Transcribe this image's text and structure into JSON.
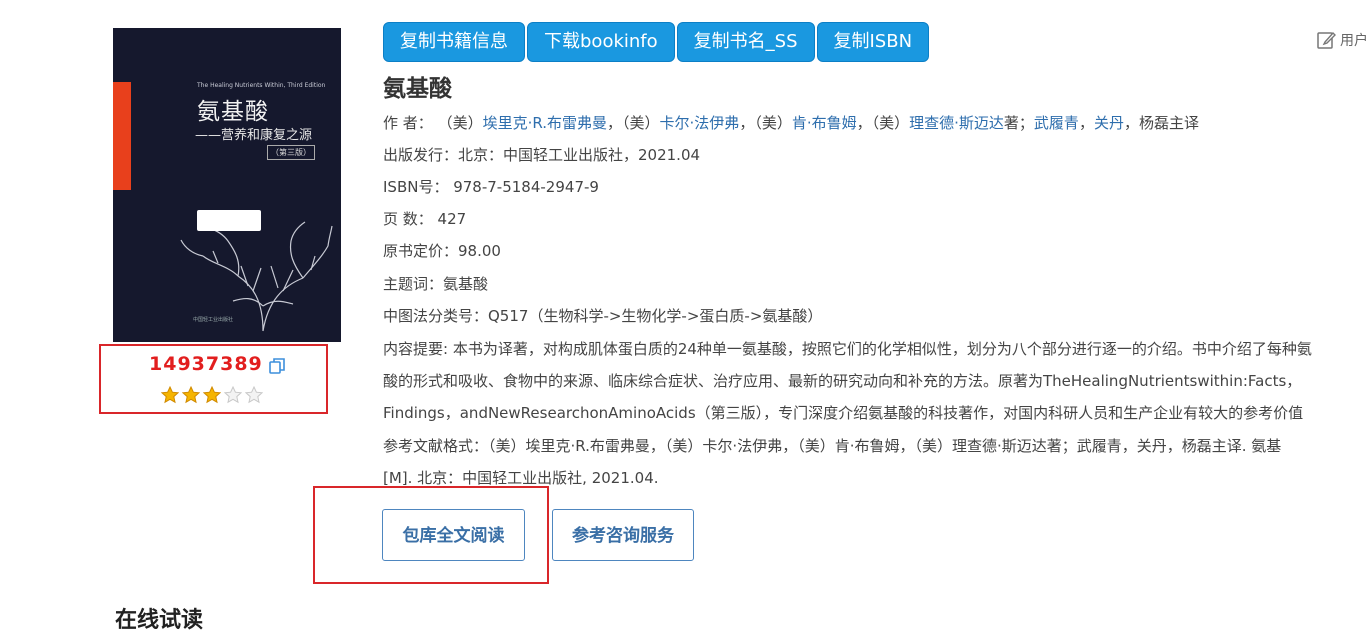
{
  "cover": {
    "english_title": "The Healing Nutrients Within, Third Edition",
    "chinese_title": "氨基酸",
    "chinese_subtitle": "——营养和康复之源",
    "edition": "（第三版）",
    "publisher_line": "中国轻工业出版社"
  },
  "book_id": {
    "number": "14937389",
    "rating": {
      "value": 3,
      "max": 5
    }
  },
  "toolbar": {
    "buttons": [
      "复制书籍信息",
      "下载bookinfo",
      "复制书名_SS",
      "复制ISBN"
    ],
    "user_label": "用户"
  },
  "book": {
    "title": "氨基酸",
    "authors": {
      "label": "作 者：",
      "prefix1": "（美）",
      "name1": "埃里克·R.布雷弗曼",
      "prefix2": "，（美）",
      "name2": "卡尔·法伊弗",
      "prefix3": "，（美）",
      "name3": "肯·布鲁姆",
      "prefix4": "，（美）",
      "name4": "理查德·斯迈达",
      "mid": "著；",
      "name5": "武履青",
      "sep": "，",
      "name6": "关丹",
      "suffix": "，杨磊主译"
    },
    "publisher": "出版发行：北京：中国轻工业出版社，2021.04",
    "isbn": "ISBN号： 978-7-5184-2947-9",
    "pages": "页 数： 427",
    "price": "原书定价：98.00",
    "subject": "主题词：氨基酸",
    "classification": "中图法分类号：Q517（生物科学->生物化学->蛋白质->氨基酸）",
    "summary_line1": "内容提要: 本书为译著，对构成肌体蛋白质的24种单一氨基酸，按照它们的化学相似性，划分为八个部分进行逐一的介绍。书中介绍了每种氨",
    "summary_line2": "酸的形式和吸收、食物中的来源、临床综合症状、治疗应用、最新的研究动向和补充的方法。原著为TheHealingNutrientswithin:Facts，",
    "summary_line3": "Findings，andNewResearchonAminoAcids（第三版），专门深度介绍氨基酸的科技著作，对国内科研人员和生产企业有较大的参考价值",
    "citation_line1": "参考文献格式：（美）埃里克·R.布雷弗曼，（美）卡尔·法伊弗，（美）肯·布鲁姆，（美）理查德·斯迈达著；武履青，关丹，杨磊主译. 氨基",
    "citation_line2": "[M]. 北京：中国轻工业出版社, 2021.04."
  },
  "actions": {
    "read_full": "包库全文阅读",
    "consult": "参考咨询服务"
  },
  "section": {
    "heading": "在线试读"
  },
  "colors": {
    "accent_blue": "#1a98e0",
    "highlight_red": "#d9262a",
    "link": "#2e6ead",
    "star": "#f5b400"
  }
}
